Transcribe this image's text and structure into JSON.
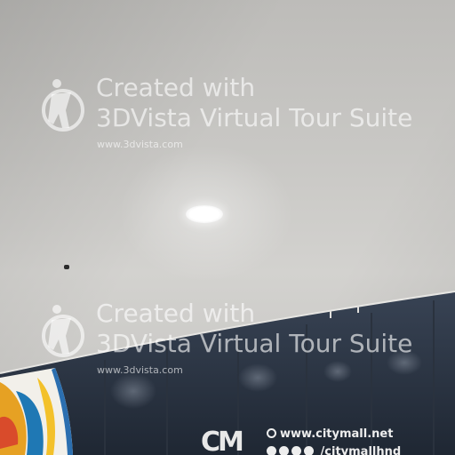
{
  "watermark": {
    "line1": "Created with",
    "line2": "3DVista Virtual Tour Suite",
    "url": "www.3dvista.com",
    "icon": "3dvista-logo-icon"
  },
  "signage": {
    "logo_text": "CM",
    "website": "www.citymall.net",
    "social_handle": "/citymallhnd",
    "icons": [
      "globe-icon",
      "facebook-icon",
      "twitter-icon",
      "instagram-icon",
      "youtube-icon"
    ]
  },
  "colors": {
    "ceiling": "#cfcdca",
    "wall": "#2c3747",
    "watermark": "#ffffff"
  }
}
